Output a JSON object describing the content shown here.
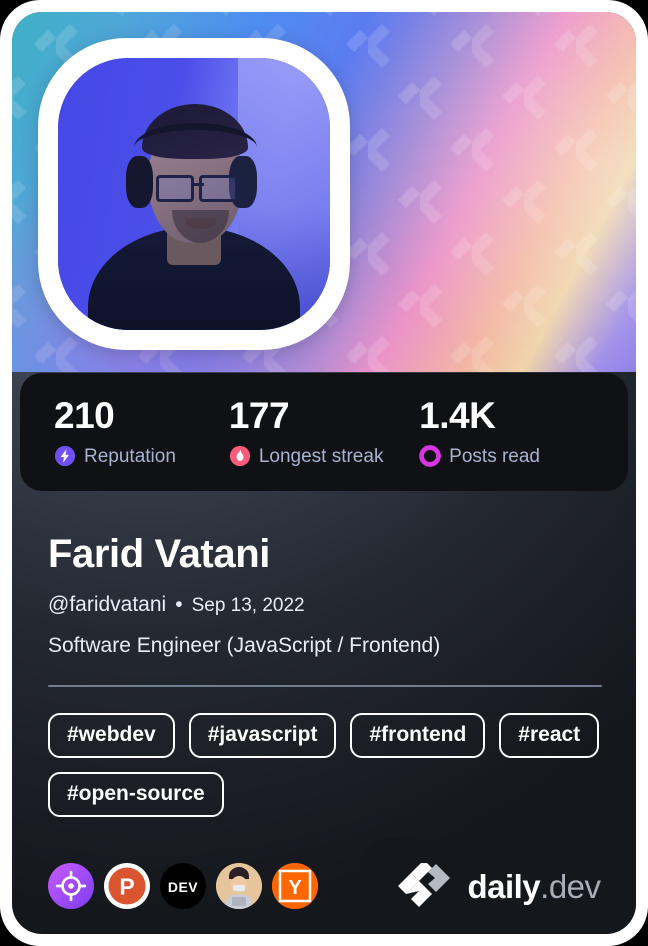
{
  "card": {
    "cover_alt": "profile-cover-gradient",
    "avatar_alt": "Farid Vatani profile photo"
  },
  "stats": [
    {
      "value": "210",
      "label": "Reputation",
      "icon": "reputation-bolt-icon",
      "color": "#6f4ff2"
    },
    {
      "value": "177",
      "label": "Longest streak",
      "icon": "streak-flame-icon",
      "color": "#fb5b7d"
    },
    {
      "value": "1.4K",
      "label": "Posts read",
      "icon": "posts-read-ring-icon",
      "color": "#d636e0"
    }
  ],
  "profile": {
    "name": "Farid Vatani",
    "handle": "@faridvatani",
    "separator": "•",
    "joined": "Sep 13, 2022",
    "title": "Software Engineer (JavaScript / Frontend)"
  },
  "tags": [
    "#webdev",
    "#javascript",
    "#frontend",
    "#react",
    "#open-source"
  ],
  "sources": [
    {
      "name": "target-source",
      "glyph": ""
    },
    {
      "name": "product-hunt-source",
      "glyph": "P"
    },
    {
      "name": "dev-to-source",
      "glyph": "DEV"
    },
    {
      "name": "devsquad-source",
      "glyph": ""
    },
    {
      "name": "hacker-news-source",
      "glyph": "Y"
    }
  ],
  "brand": {
    "name": "daily",
    "suffix": ".dev"
  }
}
